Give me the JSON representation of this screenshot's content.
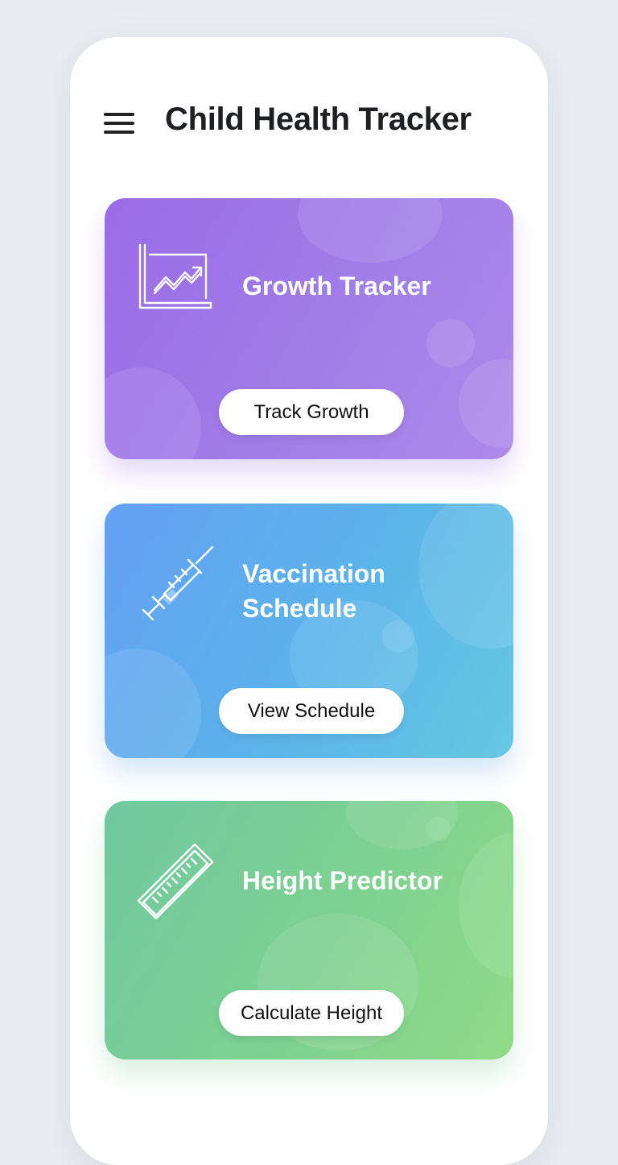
{
  "header": {
    "menu_icon": "hamburger-menu-icon",
    "title": "Child Health Tracker"
  },
  "cards": [
    {
      "icon": "growth-chart-icon",
      "title_lines": [
        "Growth Tracker"
      ],
      "button_label": "Track Growth",
      "color": "#9b6be6"
    },
    {
      "icon": "syringe-icon",
      "title_lines": [
        "Vaccination",
        "Schedule"
      ],
      "button_label": "View Schedule",
      "color": "#5bb4ea"
    },
    {
      "icon": "ruler-icon",
      "title_lines": [
        "Height Predictor"
      ],
      "button_label": "Calculate Height",
      "color": "#7dd191"
    }
  ]
}
